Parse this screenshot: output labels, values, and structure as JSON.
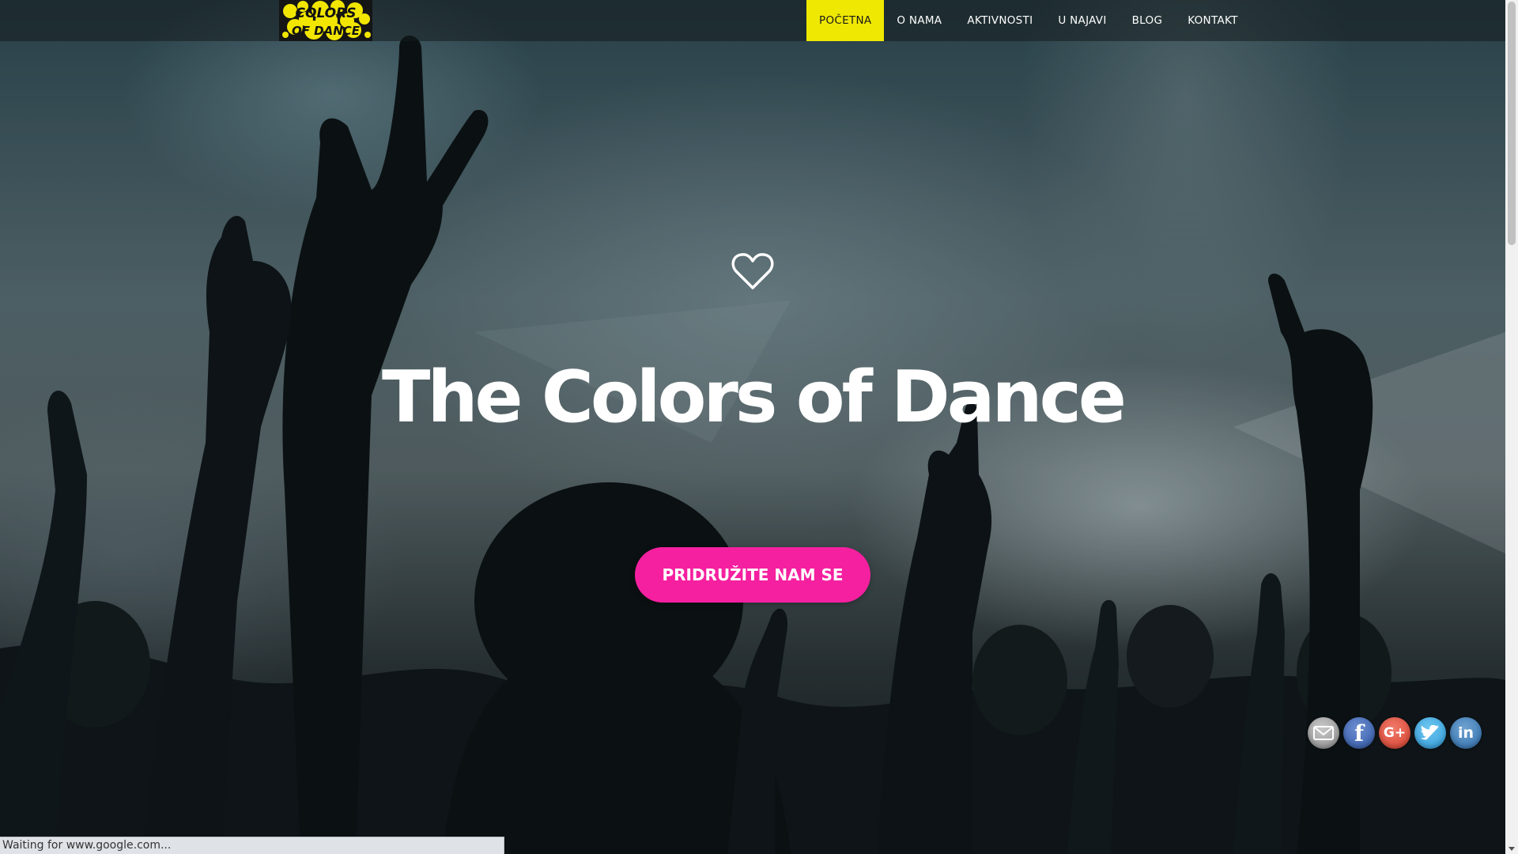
{
  "logo": {
    "text_line1": "COLORS",
    "text_line2": "OF DANCE"
  },
  "nav": {
    "items": [
      {
        "label": "POČETNA",
        "active": true
      },
      {
        "label": "O NAMA",
        "active": false
      },
      {
        "label": "AKTIVNOSTI",
        "active": false
      },
      {
        "label": "U NAJAVI",
        "active": false
      },
      {
        "label": "BLOG",
        "active": false
      },
      {
        "label": "KONTAKT",
        "active": false
      }
    ]
  },
  "hero": {
    "icon": "heart-outline-icon",
    "title": "The Colors of Dance",
    "cta_label": "PRIDRUŽITE NAM SE"
  },
  "social": [
    {
      "name": "email-icon",
      "glyph": "✉"
    },
    {
      "name": "facebook-icon",
      "glyph": "f"
    },
    {
      "name": "google-plus-icon",
      "glyph": "G+"
    },
    {
      "name": "twitter-icon",
      "glyph": ""
    },
    {
      "name": "linkedin-icon",
      "glyph": "in"
    }
  ],
  "status_bar": {
    "text": "Waiting for www.google.com..."
  },
  "colors": {
    "nav_active_bg": "#efe802",
    "cta_bg": "#f520a0",
    "logo_yellow": "#f2e600"
  }
}
